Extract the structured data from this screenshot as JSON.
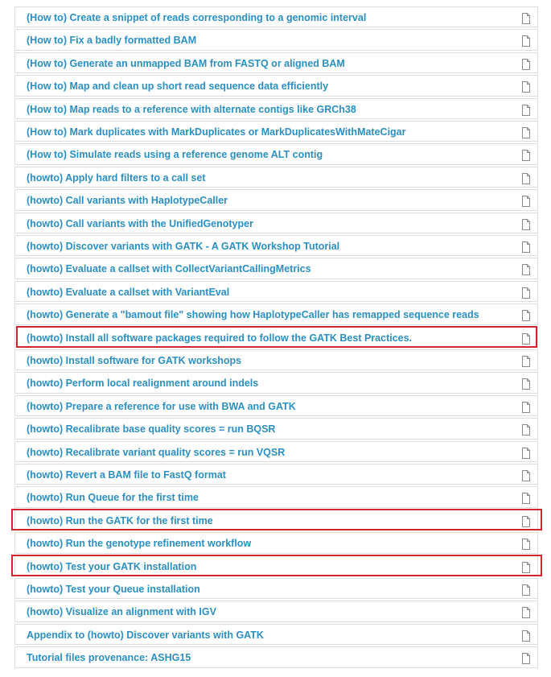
{
  "items": [
    {
      "label": "(How to) Create a snippet of reads corresponding to a genomic interval",
      "highlighted": false
    },
    {
      "label": "(How to) Fix a badly formatted BAM",
      "highlighted": false
    },
    {
      "label": "(How to) Generate an unmapped BAM from FASTQ or aligned BAM",
      "highlighted": false
    },
    {
      "label": "(How to) Map and clean up short read sequence data efficiently",
      "highlighted": false
    },
    {
      "label": "(How to) Map reads to a reference with alternate contigs like GRCh38",
      "highlighted": false
    },
    {
      "label": "(How to) Mark duplicates with MarkDuplicates or MarkDuplicatesWithMateCigar",
      "highlighted": false
    },
    {
      "label": "(How to) Simulate reads using a reference genome ALT contig",
      "highlighted": false
    },
    {
      "label": "(howto) Apply hard filters to a call set",
      "highlighted": false
    },
    {
      "label": "(howto) Call variants with HaplotypeCaller",
      "highlighted": false
    },
    {
      "label": "(howto) Call variants with the UnifiedGenotyper",
      "highlighted": false
    },
    {
      "label": "(howto) Discover variants with GATK - A GATK Workshop Tutorial",
      "highlighted": false
    },
    {
      "label": "(howto) Evaluate a callset with CollectVariantCallingMetrics",
      "highlighted": false
    },
    {
      "label": "(howto) Evaluate a callset with VariantEval",
      "highlighted": false
    },
    {
      "label": "(howto) Generate a \"bamout file\" showing how HaplotypeCaller has remapped sequence reads",
      "highlighted": false
    },
    {
      "label": "(howto) Install all software packages required to follow the GATK Best Practices.",
      "highlighted": true
    },
    {
      "label": "(howto) Install software for GATK workshops",
      "highlighted": false
    },
    {
      "label": "(howto) Perform local realignment around indels",
      "highlighted": false
    },
    {
      "label": "(howto) Prepare a reference for use with BWA and GATK",
      "highlighted": false
    },
    {
      "label": "(howto) Recalibrate base quality scores = run BQSR",
      "highlighted": false
    },
    {
      "label": "(howto) Recalibrate variant quality scores = run VQSR",
      "highlighted": false
    },
    {
      "label": "(howto) Revert a BAM file to FastQ format",
      "highlighted": false
    },
    {
      "label": "(howto) Run Queue for the first time",
      "highlighted": false
    },
    {
      "label": "(howto) Run the GATK for the first time",
      "highlighted": true
    },
    {
      "label": "(howto) Run the genotype refinement workflow",
      "highlighted": false
    },
    {
      "label": "(howto) Test your GATK installation",
      "highlighted": true
    },
    {
      "label": "(howto) Test your Queue installation",
      "highlighted": false
    },
    {
      "label": "(howto) Visualize an alignment with IGV",
      "highlighted": false
    },
    {
      "label": "Appendix to (howto) Discover variants with GATK",
      "highlighted": false
    },
    {
      "label": "Tutorial files provenance: ASHG15",
      "highlighted": false
    }
  ],
  "icon": "document-icon",
  "colors": {
    "link": "#2b8fc2",
    "border": "#dddddd",
    "highlight": "#d0262f",
    "icon": "#8a8a8a"
  }
}
